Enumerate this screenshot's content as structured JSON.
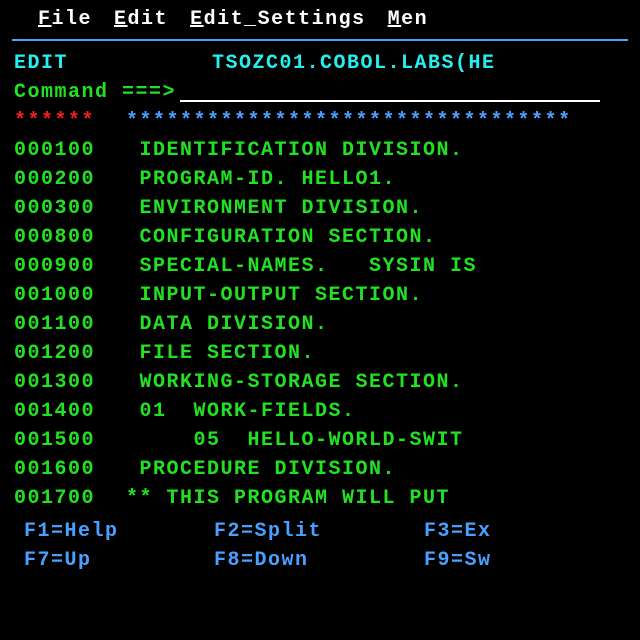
{
  "menubar": {
    "items": [
      {
        "hotkey": "F",
        "rest": "ile"
      },
      {
        "hotkey": "E",
        "rest": "dit"
      },
      {
        "hotkey": "E",
        "rest": "dit_Settings"
      },
      {
        "hotkey": "M",
        "rest": "en"
      }
    ]
  },
  "header": {
    "mode": "EDIT",
    "dataset": "TSOZC01.COBOL.LABS(HE"
  },
  "command": {
    "label": "Command ===>",
    "value": ""
  },
  "topmarker": {
    "left": "******",
    "stars": "*********************************"
  },
  "lines": [
    {
      "num": "000100",
      "text": " IDENTIFICATION DIVISION."
    },
    {
      "num": "000200",
      "text": " PROGRAM-ID. HELLO1."
    },
    {
      "num": "000300",
      "text": " ENVIRONMENT DIVISION."
    },
    {
      "num": "000800",
      "text": " CONFIGURATION SECTION."
    },
    {
      "num": "000900",
      "text": " SPECIAL-NAMES.   SYSIN IS"
    },
    {
      "num": "001000",
      "text": " INPUT-OUTPUT SECTION."
    },
    {
      "num": "001100",
      "text": " DATA DIVISION."
    },
    {
      "num": "001200",
      "text": " FILE SECTION."
    },
    {
      "num": "001300",
      "text": " WORKING-STORAGE SECTION."
    },
    {
      "num": "001400",
      "text": " 01  WORK-FIELDS."
    },
    {
      "num": "001500",
      "text": "     05  HELLO-WORLD-SWIT"
    },
    {
      "num": "001600",
      "text": " PROCEDURE DIVISION."
    },
    {
      "num": "001700",
      "text": "** THIS PROGRAM WILL PUT "
    }
  ],
  "fkeys": {
    "row1": {
      "a": "F1=Help",
      "b": "F2=Split",
      "c": "F3=Ex"
    },
    "row2": {
      "a": "F7=Up",
      "b": "F8=Down",
      "c": "F9=Sw"
    }
  }
}
